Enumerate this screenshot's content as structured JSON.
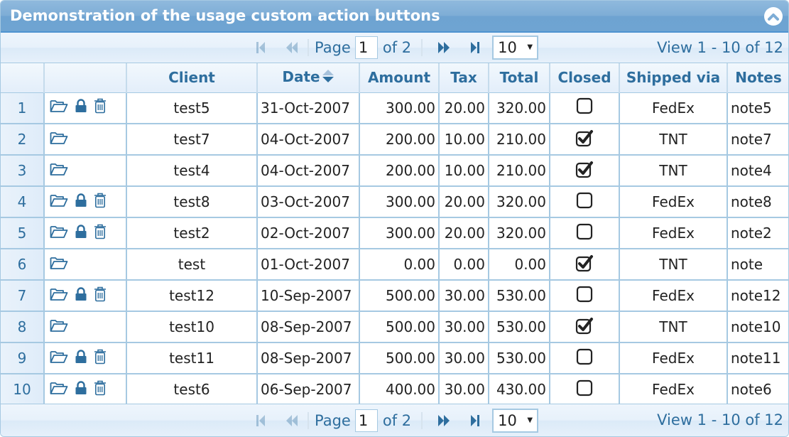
{
  "caption": {
    "title": "Demonstration of the usage custom action buttons",
    "collapse_icon": "chevron-up-circle-icon"
  },
  "pager": {
    "page_label": "Page",
    "current_page": "1",
    "of_label": "of 2",
    "rows_per_page": "10",
    "view_info": "View 1 - 10 of 12",
    "icons": [
      "first-page-icon",
      "prev-page-icon",
      "next-page-icon",
      "last-page-icon"
    ]
  },
  "columns": [
    {
      "key": "rn",
      "label": ""
    },
    {
      "key": "actions",
      "label": ""
    },
    {
      "key": "client",
      "label": "Client"
    },
    {
      "key": "date",
      "label": "Date",
      "sorted": true
    },
    {
      "key": "amount",
      "label": "Amount"
    },
    {
      "key": "tax",
      "label": "Tax"
    },
    {
      "key": "total",
      "label": "Total"
    },
    {
      "key": "closed",
      "label": "Closed"
    },
    {
      "key": "ship",
      "label": "Shipped via"
    },
    {
      "key": "notes",
      "label": "Notes"
    }
  ],
  "colors": {
    "accent": "#2e6e9e",
    "border": "#a6c9e2",
    "caption_bg": "#7eadd6"
  },
  "rows": [
    {
      "rn": "1",
      "actions": [
        "edit",
        "lock",
        "delete"
      ],
      "client": "test5",
      "date": "31-Oct-2007",
      "amount": "300.00",
      "tax": "20.00",
      "total": "320.00",
      "closed": false,
      "ship": "FedEx",
      "notes": "note5"
    },
    {
      "rn": "2",
      "actions": [
        "edit"
      ],
      "client": "test7",
      "date": "04-Oct-2007",
      "amount": "200.00",
      "tax": "10.00",
      "total": "210.00",
      "closed": true,
      "ship": "TNT",
      "notes": "note7"
    },
    {
      "rn": "3",
      "actions": [
        "edit"
      ],
      "client": "test4",
      "date": "04-Oct-2007",
      "amount": "200.00",
      "tax": "10.00",
      "total": "210.00",
      "closed": true,
      "ship": "TNT",
      "notes": "note4"
    },
    {
      "rn": "4",
      "actions": [
        "edit",
        "lock",
        "delete"
      ],
      "client": "test8",
      "date": "03-Oct-2007",
      "amount": "300.00",
      "tax": "20.00",
      "total": "320.00",
      "closed": false,
      "ship": "FedEx",
      "notes": "note8"
    },
    {
      "rn": "5",
      "actions": [
        "edit",
        "lock",
        "delete"
      ],
      "client": "test2",
      "date": "02-Oct-2007",
      "amount": "300.00",
      "tax": "20.00",
      "total": "320.00",
      "closed": false,
      "ship": "FedEx",
      "notes": "note2"
    },
    {
      "rn": "6",
      "actions": [
        "edit"
      ],
      "client": "test",
      "date": "01-Oct-2007",
      "amount": "0.00",
      "tax": "0.00",
      "total": "0.00",
      "closed": true,
      "ship": "TNT",
      "notes": "note"
    },
    {
      "rn": "7",
      "actions": [
        "edit",
        "lock",
        "delete"
      ],
      "client": "test12",
      "date": "10-Sep-2007",
      "amount": "500.00",
      "tax": "30.00",
      "total": "530.00",
      "closed": false,
      "ship": "FedEx",
      "notes": "note12"
    },
    {
      "rn": "8",
      "actions": [
        "edit"
      ],
      "client": "test10",
      "date": "08-Sep-2007",
      "amount": "500.00",
      "tax": "30.00",
      "total": "530.00",
      "closed": true,
      "ship": "TNT",
      "notes": "note10"
    },
    {
      "rn": "9",
      "actions": [
        "edit",
        "lock",
        "delete"
      ],
      "client": "test11",
      "date": "08-Sep-2007",
      "amount": "500.00",
      "tax": "30.00",
      "total": "530.00",
      "closed": false,
      "ship": "FedEx",
      "notes": "note11"
    },
    {
      "rn": "10",
      "actions": [
        "edit",
        "lock",
        "delete"
      ],
      "client": "test6",
      "date": "06-Sep-2007",
      "amount": "400.00",
      "tax": "30.00",
      "total": "430.00",
      "closed": false,
      "ship": "FedEx",
      "notes": "note6"
    }
  ]
}
